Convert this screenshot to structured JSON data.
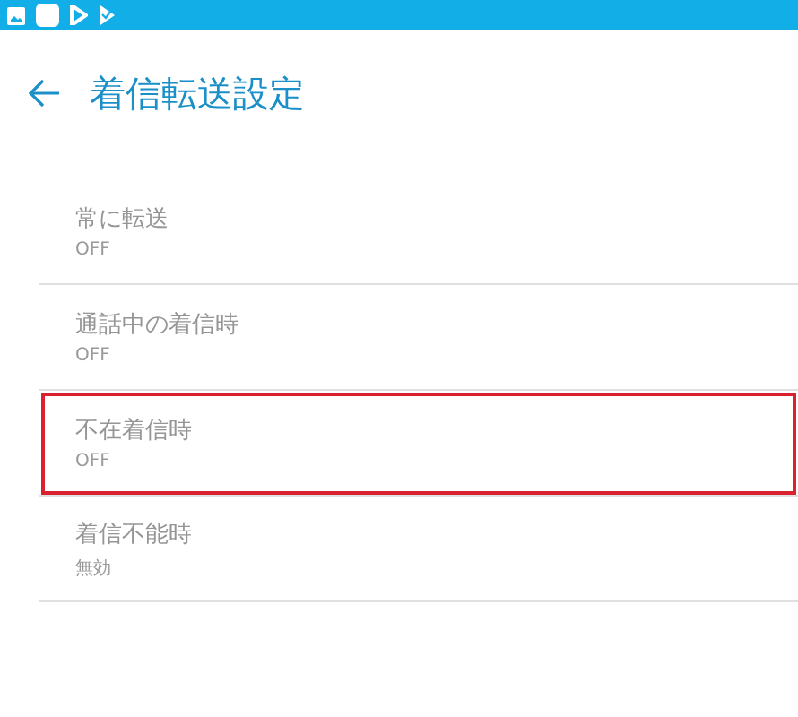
{
  "header": {
    "title": "着信転送設定"
  },
  "settings": [
    {
      "label": "常に転送",
      "value": "OFF",
      "disabled": true,
      "highlighted": false
    },
    {
      "label": "通話中の着信時",
      "value": "OFF",
      "disabled": true,
      "highlighted": false
    },
    {
      "label": "不在着信時",
      "value": "OFF",
      "disabled": true,
      "highlighted": true
    },
    {
      "label": "着信不能時",
      "value": "無効",
      "disabled": true,
      "highlighted": false
    }
  ]
}
